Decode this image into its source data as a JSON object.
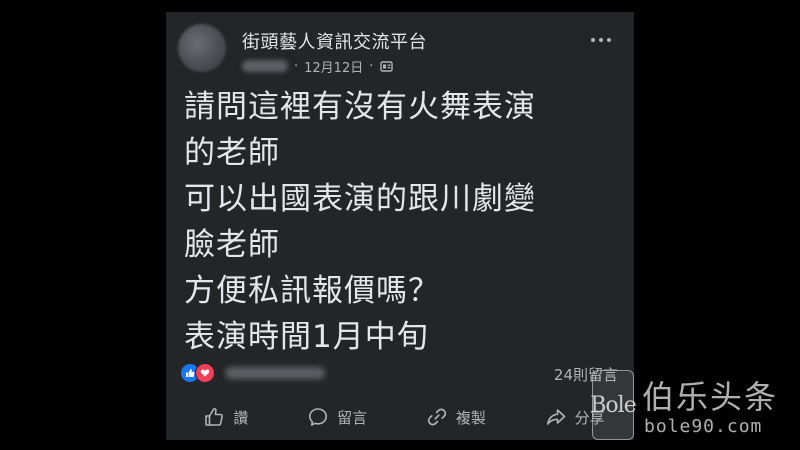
{
  "post": {
    "group_name": "街頭藝人資訊交流平台",
    "date": "12月12日",
    "separator": "·",
    "body_lines": [
      "請問這裡有沒有火舞表演",
      "的老師",
      "可以出國表演的跟川劇變",
      "臉老師",
      "方便私訊報價嗎？",
      "表演時間1月中旬"
    ],
    "comment_count": "24則留言",
    "reactions": [
      "like",
      "love"
    ]
  },
  "actions": {
    "like_label": "讚",
    "comment_label": "留言",
    "copy_label": "複製",
    "share_label": "分享"
  },
  "watermark": {
    "logo_text": "Bole",
    "title": "伯乐头条",
    "url": "bole90.com"
  },
  "icons": {
    "more": "more-horizontal-icon",
    "audience": "group-audience-icon",
    "like": "thumbs-up-icon",
    "comment": "comment-bubble-icon",
    "copy": "link-icon",
    "share": "share-arrow-icon"
  },
  "colors": {
    "background": "#000000",
    "card": "#242526",
    "primary_text": "#e4e6eb",
    "secondary_text": "#b0b3b8",
    "like_blue": "#1877f2",
    "love_red": "#f33e58"
  }
}
